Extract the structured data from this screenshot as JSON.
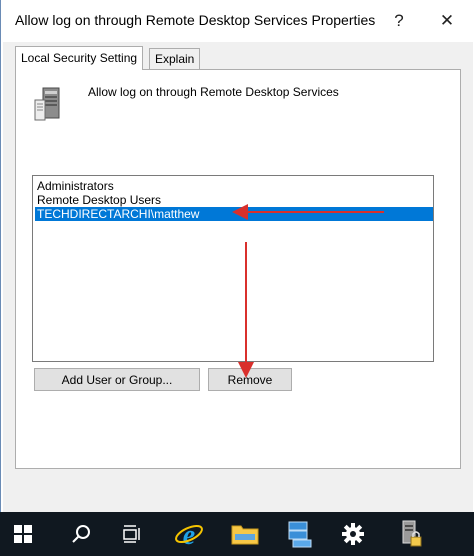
{
  "window": {
    "title": "Allow log on through Remote Desktop Services Properties",
    "help_glyph": "?",
    "close_glyph": "✕"
  },
  "tabs": [
    {
      "label": "Local Security Setting",
      "active": true
    },
    {
      "label": "Explain",
      "active": false
    }
  ],
  "policy": {
    "icon": "server-icon",
    "name": "Allow log on through Remote Desktop Services"
  },
  "members": {
    "items": [
      "Administrators",
      "Remote Desktop Users",
      "TECHDIRECTARCHI\\matthew"
    ],
    "selected_index": 2
  },
  "buttons": {
    "add_label": "Add User or Group...",
    "remove_label": "Remove"
  },
  "taskbar": {
    "items": [
      "windows-start-icon",
      "search-icon",
      "task-view-icon",
      "internet-explorer-icon",
      "file-explorer-icon",
      "server-manager-icon",
      "settings-gear-icon",
      "local-security-policy-icon"
    ],
    "background": "#101820"
  },
  "colors": {
    "selection": "#0078d7",
    "annotation_arrow": "#d9302c"
  }
}
